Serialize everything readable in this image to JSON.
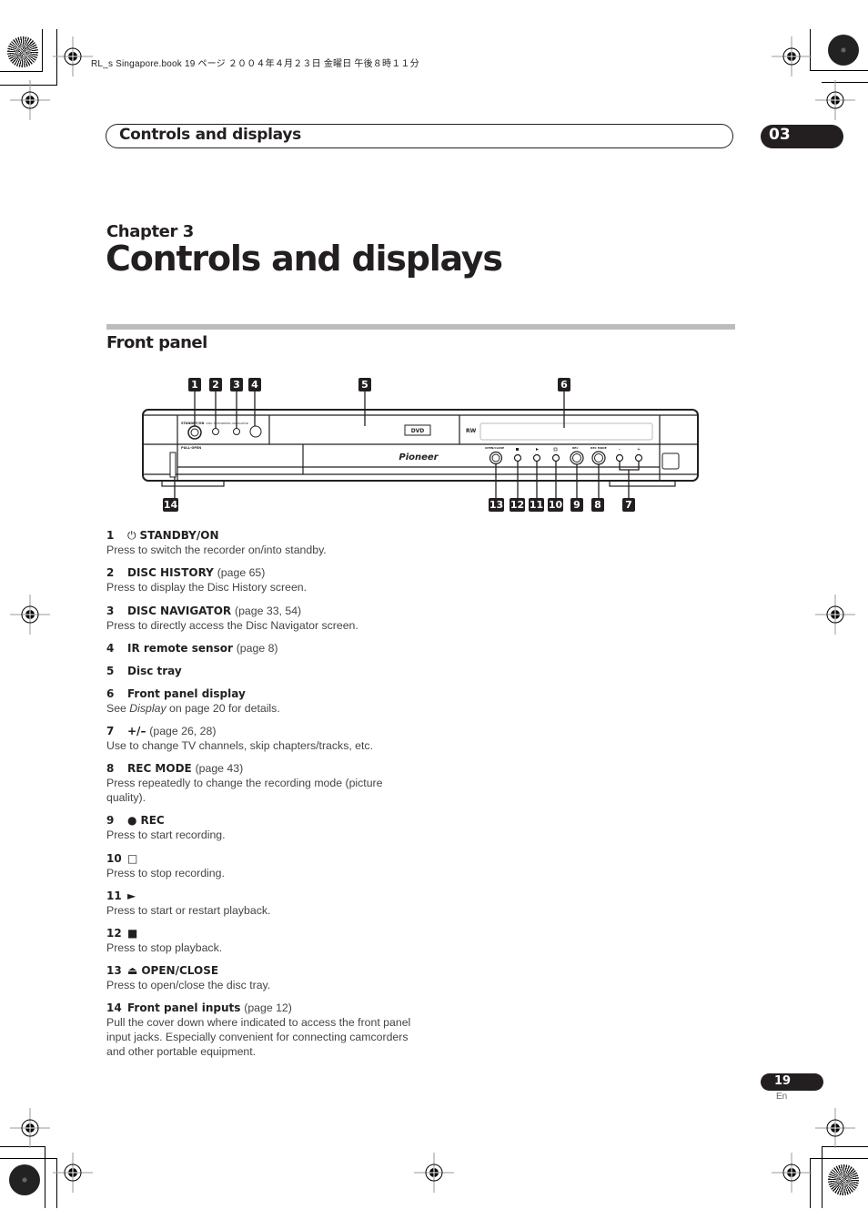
{
  "file_stamp": "RL_s Singapore.book 19 ページ ２００４年４月２３日 金曜日 午後８時１１分",
  "running_header": {
    "title": "Controls and displays",
    "chapter_number": "03"
  },
  "chapter": {
    "label": "Chapter 3",
    "title": "Controls and displays"
  },
  "section": {
    "title": "Front panel"
  },
  "diagram": {
    "brand": "Pioneer",
    "disc_logo": "DVD",
    "format_logo": "RW",
    "panel_labels": {
      "standby_on": "STANDBY/ON",
      "disc_history": "DISC HISTORY",
      "disc_navigator": "DISC NAVIGATOR",
      "pull_open": "PULL-OPEN",
      "open_close": "OPEN/CLOSE",
      "rec": "REC",
      "rec_mode": "REC MODE",
      "minus": "–",
      "plus": "+"
    },
    "callouts": {
      "c1": "1",
      "c2": "2",
      "c3": "3",
      "c4": "4",
      "c5": "5",
      "c6": "6",
      "c7": "7",
      "c8": "8",
      "c9": "9",
      "c10": "10",
      "c11": "11",
      "c12": "12",
      "c13": "13",
      "c14": "14"
    }
  },
  "items": [
    {
      "num": "1",
      "icon": "power-icon",
      "glyph": "⏻",
      "name": "STANDBY/ON",
      "ref": "",
      "desc": "Press to switch the recorder on/into standby."
    },
    {
      "num": "2",
      "icon": "",
      "glyph": "",
      "name": "DISC HISTORY",
      "ref": "(page 65)",
      "desc": "Press to display the Disc History screen."
    },
    {
      "num": "3",
      "icon": "",
      "glyph": "",
      "name": "DISC NAVIGATOR",
      "ref": "(page 33, 54)",
      "desc": "Press to directly access the Disc Navigator screen."
    },
    {
      "num": "4",
      "icon": "",
      "glyph": "",
      "name": "IR remote sensor",
      "ref": "(page 8)",
      "desc": ""
    },
    {
      "num": "5",
      "icon": "",
      "glyph": "",
      "name": "Disc tray",
      "ref": "",
      "desc": ""
    },
    {
      "num": "6",
      "icon": "",
      "glyph": "",
      "name": "Front panel display",
      "ref": "",
      "desc_pre": "See ",
      "desc_em": "Display",
      "desc": " on page 20 for details."
    },
    {
      "num": "7",
      "icon": "",
      "glyph": "",
      "name": "+/–",
      "ref": "(page 26, 28)",
      "desc": "Use to change TV channels, skip chapters/tracks, etc."
    },
    {
      "num": "8",
      "icon": "",
      "glyph": "",
      "name": "REC MODE",
      "ref": "(page 43)",
      "desc": "Press repeatedly to change the recording mode (picture quality)."
    },
    {
      "num": "9",
      "icon": "record-icon",
      "glyph": "●",
      "name": "REC",
      "ref": "",
      "desc": "Press to start recording."
    },
    {
      "num": "10",
      "icon": "stop-record-icon",
      "glyph": "□",
      "name": "",
      "ref": "",
      "desc": "Press to stop recording."
    },
    {
      "num": "11",
      "icon": "play-icon",
      "glyph": "►",
      "name": "",
      "ref": "",
      "desc": "Press to start or restart playback."
    },
    {
      "num": "12",
      "icon": "stop-icon",
      "glyph": "■",
      "name": "",
      "ref": "",
      "desc": "Press to stop playback."
    },
    {
      "num": "13",
      "icon": "eject-icon",
      "glyph": "⏏",
      "name": "OPEN/CLOSE",
      "ref": "",
      "desc": "Press to open/close the disc tray."
    },
    {
      "num": "14",
      "icon": "",
      "glyph": "",
      "name": "Front panel inputs",
      "ref": "(page 12)",
      "desc": "Pull the cover down where indicated to access the front panel input jacks. Especially convenient for connecting camcorders and other portable equipment."
    }
  ],
  "footer": {
    "page_number": "19",
    "language": "En"
  }
}
